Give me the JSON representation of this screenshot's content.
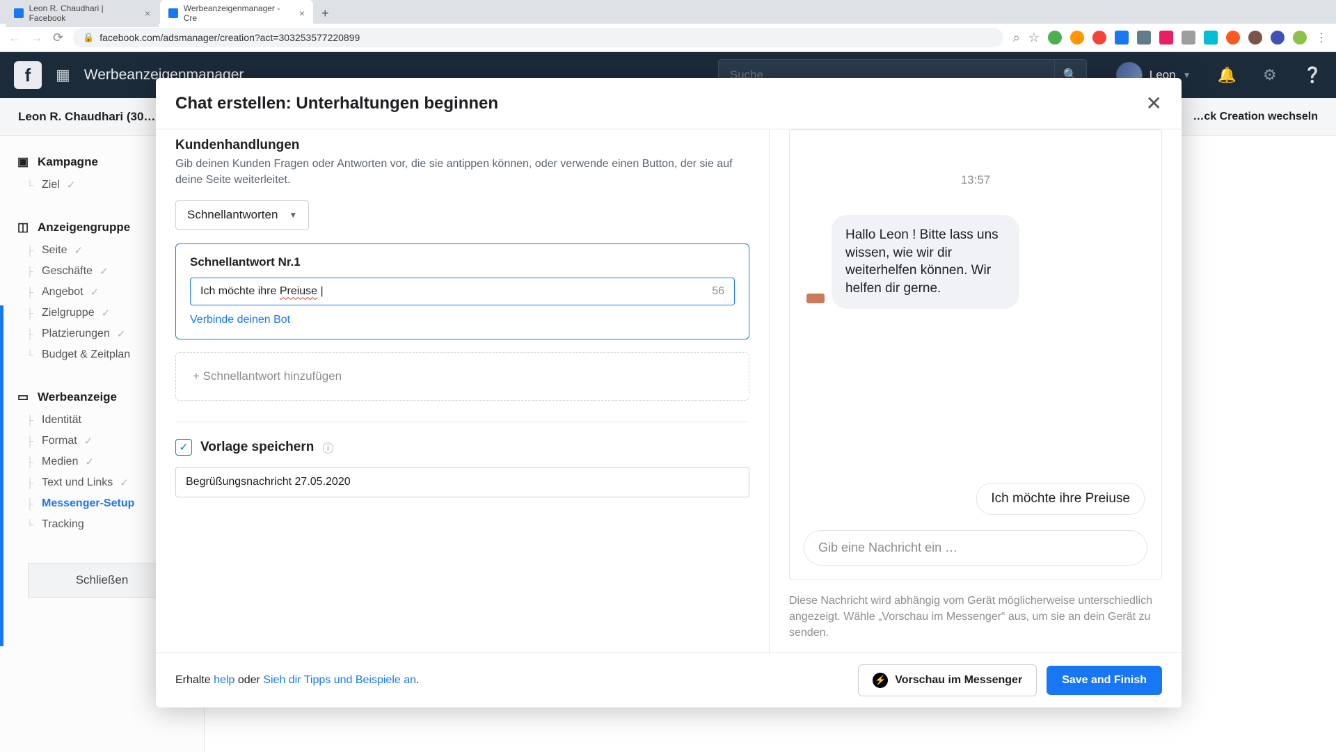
{
  "browser": {
    "tabs": [
      {
        "title": "Leon R. Chaudhari | Facebook"
      },
      {
        "title": "Werbeanzeigenmanager - Cre"
      }
    ],
    "url": "facebook.com/adsmanager/creation?act=303253577220899"
  },
  "topbar": {
    "app_title": "Werbeanzeigenmanager",
    "search_placeholder": "Suche",
    "user_name": "Leon"
  },
  "page": {
    "account_name": "Leon R. Chaudhari (30…",
    "quick_toggle": "…ck Creation wechseln"
  },
  "sidebar": {
    "kampagne": {
      "head": "Kampagne",
      "ziel": "Ziel"
    },
    "anzeigengruppe": {
      "head": "Anzeigengruppe",
      "seite": "Seite",
      "geschaefte": "Geschäfte",
      "angebot": "Angebot",
      "zielgruppe": "Zielgruppe",
      "platzierungen": "Platzierungen",
      "budget": "Budget & Zeitplan"
    },
    "werbeanzeige": {
      "head": "Werbeanzeige",
      "identitaet": "Identität",
      "format": "Format",
      "medien": "Medien",
      "text": "Text und Links",
      "messenger": "Messenger-Setup",
      "tracking": "Tracking"
    },
    "schliessen": "Schließen"
  },
  "modal": {
    "title": "Chat erstellen: Unterhaltungen beginnen",
    "sec_title": "Kundenhandlungen",
    "sec_sub": "Gib deinen Kunden Fragen oder Antworten vor, die sie antippen können, oder verwende einen Button, der sie auf deine Seite weiterleitet.",
    "dropdown_label": "Schnellantworten",
    "qa_title": "Schnellantwort Nr.1",
    "qa_value_pre": "Ich möchte ihre ",
    "qa_value_typo": "Preiuse",
    "qa_count": "56",
    "qa_link": "Verbinde deinen Bot",
    "qa_add": "+ Schnellantwort hinzufügen",
    "save_label": "Vorlage speichern",
    "template_value": "Begrüßungsnachricht 27.05.2020",
    "preview": {
      "time": "13:57",
      "message": "Hallo Leon ! Bitte lass uns wissen, wie wir dir weiterhelfen können. Wir helfen dir gerne.",
      "chip": "Ich möchte ihre Preiuse",
      "compose_ph": "Gib eine Nachricht ein …",
      "note": "Diese Nachricht wird abhängig vom Gerät möglicherweise unterschiedlich angezeigt. Wähle „Vorschau im Messenger“ aus, um sie an dein Gerät zu senden."
    },
    "footer": {
      "pre": "Erhalte ",
      "help": "help",
      "mid": " oder ",
      "tips": "Sieh dir Tipps und Beispiele an",
      "dot": ".",
      "preview_btn": "Vorschau im Messenger",
      "save_btn": "Save and Finish"
    }
  }
}
